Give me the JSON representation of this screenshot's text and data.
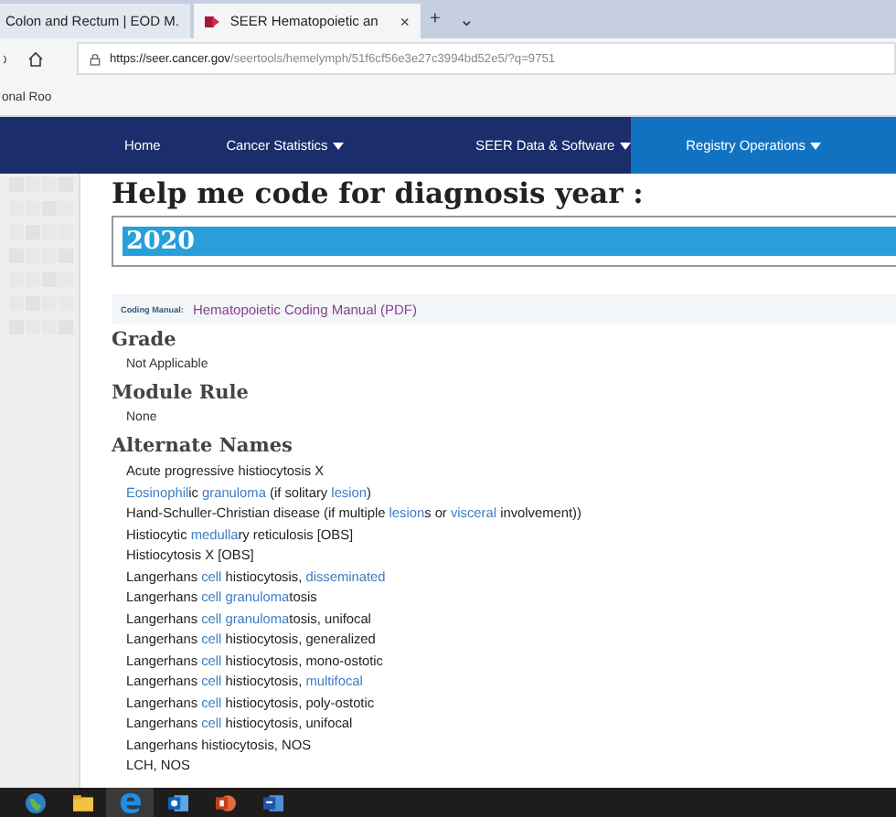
{
  "browser": {
    "tabs": [
      {
        "title": "Colon and Rectum | EOD M.",
        "selected": false
      },
      {
        "title": "SEER Hematopoietic an",
        "selected": true,
        "close": "×"
      }
    ],
    "new_tab": "+",
    "tab_menu": "⌄",
    "address": {
      "host": "https://seer.cancer.gov",
      "path": "/seertools/hemelymph/51f6cf56e3e27c3994bd52e5/?q=9751"
    },
    "favorites": [
      "onal Roo"
    ]
  },
  "nav": [
    {
      "label": "Home",
      "dropdown": false,
      "selected": false
    },
    {
      "label": "Cancer Statistics",
      "dropdown": true,
      "selected": false
    },
    {
      "label": "SEER Data & Software",
      "dropdown": true,
      "selected": false
    },
    {
      "label": "Registry Operations",
      "dropdown": true,
      "selected": true
    }
  ],
  "heading": "Help me code for diagnosis year :",
  "year_field": {
    "value": "2020",
    "selected": true
  },
  "coding_manual": {
    "label": "Coding Manual:",
    "link": "Hematopoietic Coding Manual (PDF)"
  },
  "sections": [
    {
      "title": "Grade",
      "value": "Not Applicable"
    },
    {
      "title": "Module Rule",
      "value": "None"
    }
  ],
  "alternate_names": {
    "title": "Alternate Names",
    "items": [
      [
        {
          "kind": "text",
          "text": "Acute progressive histiocytosis X"
        }
      ],
      [
        {
          "kind": "link",
          "text": "Eosinophil"
        },
        {
          "kind": "text",
          "text": "ic "
        },
        {
          "kind": "link",
          "text": "granuloma"
        },
        {
          "kind": "text",
          "text": " (if solitary "
        },
        {
          "kind": "link",
          "text": "lesion"
        },
        {
          "kind": "text",
          "text": ")"
        }
      ],
      [
        {
          "kind": "text",
          "text": "Hand-Schuller-Christian disease (if multiple "
        },
        {
          "kind": "link",
          "text": "lesion"
        },
        {
          "kind": "text",
          "text": "s or "
        },
        {
          "kind": "link",
          "text": "visceral"
        },
        {
          "kind": "text",
          "text": " involvement))"
        }
      ],
      [
        {
          "kind": "text",
          "text": "Histiocytic "
        },
        {
          "kind": "link",
          "text": "medulla"
        },
        {
          "kind": "text",
          "text": "ry reticulosis [OBS]"
        }
      ],
      [
        {
          "kind": "text",
          "text": "Histiocytosis X [OBS]"
        }
      ],
      [
        {
          "kind": "text",
          "text": "Langerhans "
        },
        {
          "kind": "link",
          "text": "cell"
        },
        {
          "kind": "text",
          "text": " histiocytosis, "
        },
        {
          "kind": "link",
          "text": "disseminated"
        }
      ],
      [
        {
          "kind": "text",
          "text": "Langerhans "
        },
        {
          "kind": "link",
          "text": "cell granuloma"
        },
        {
          "kind": "text",
          "text": "tosis"
        }
      ],
      [
        {
          "kind": "text",
          "text": "Langerhans "
        },
        {
          "kind": "link",
          "text": "cell granuloma"
        },
        {
          "kind": "text",
          "text": "tosis, unifocal"
        }
      ],
      [
        {
          "kind": "text",
          "text": "Langerhans "
        },
        {
          "kind": "link",
          "text": "cell"
        },
        {
          "kind": "text",
          "text": " histiocytosis, generalized"
        }
      ],
      [
        {
          "kind": "text",
          "text": "Langerhans "
        },
        {
          "kind": "link",
          "text": "cell"
        },
        {
          "kind": "text",
          "text": " histiocytosis, mono-ostotic"
        }
      ],
      [
        {
          "kind": "text",
          "text": "Langerhans "
        },
        {
          "kind": "link",
          "text": "cell"
        },
        {
          "kind": "text",
          "text": " histiocytosis, "
        },
        {
          "kind": "link",
          "text": "multifocal"
        }
      ],
      [
        {
          "kind": "text",
          "text": "Langerhans "
        },
        {
          "kind": "link",
          "text": "cell"
        },
        {
          "kind": "text",
          "text": " histiocytosis, poly-ostotic"
        }
      ],
      [
        {
          "kind": "text",
          "text": "Langerhans "
        },
        {
          "kind": "link",
          "text": "cell"
        },
        {
          "kind": "text",
          "text": " histiocytosis, unifocal"
        }
      ],
      [
        {
          "kind": "text",
          "text": "Langerhans histiocytosis, NOS"
        }
      ],
      [
        {
          "kind": "text",
          "text": "LCH, NOS"
        }
      ]
    ]
  },
  "taskbar": [
    {
      "kind": "globe",
      "selected": false
    },
    {
      "kind": "folder",
      "selected": false
    },
    {
      "kind": "browser",
      "selected": true
    },
    {
      "kind": "mail",
      "selected": false
    },
    {
      "kind": "slides",
      "selected": false
    },
    {
      "kind": "document",
      "selected": false
    }
  ]
}
